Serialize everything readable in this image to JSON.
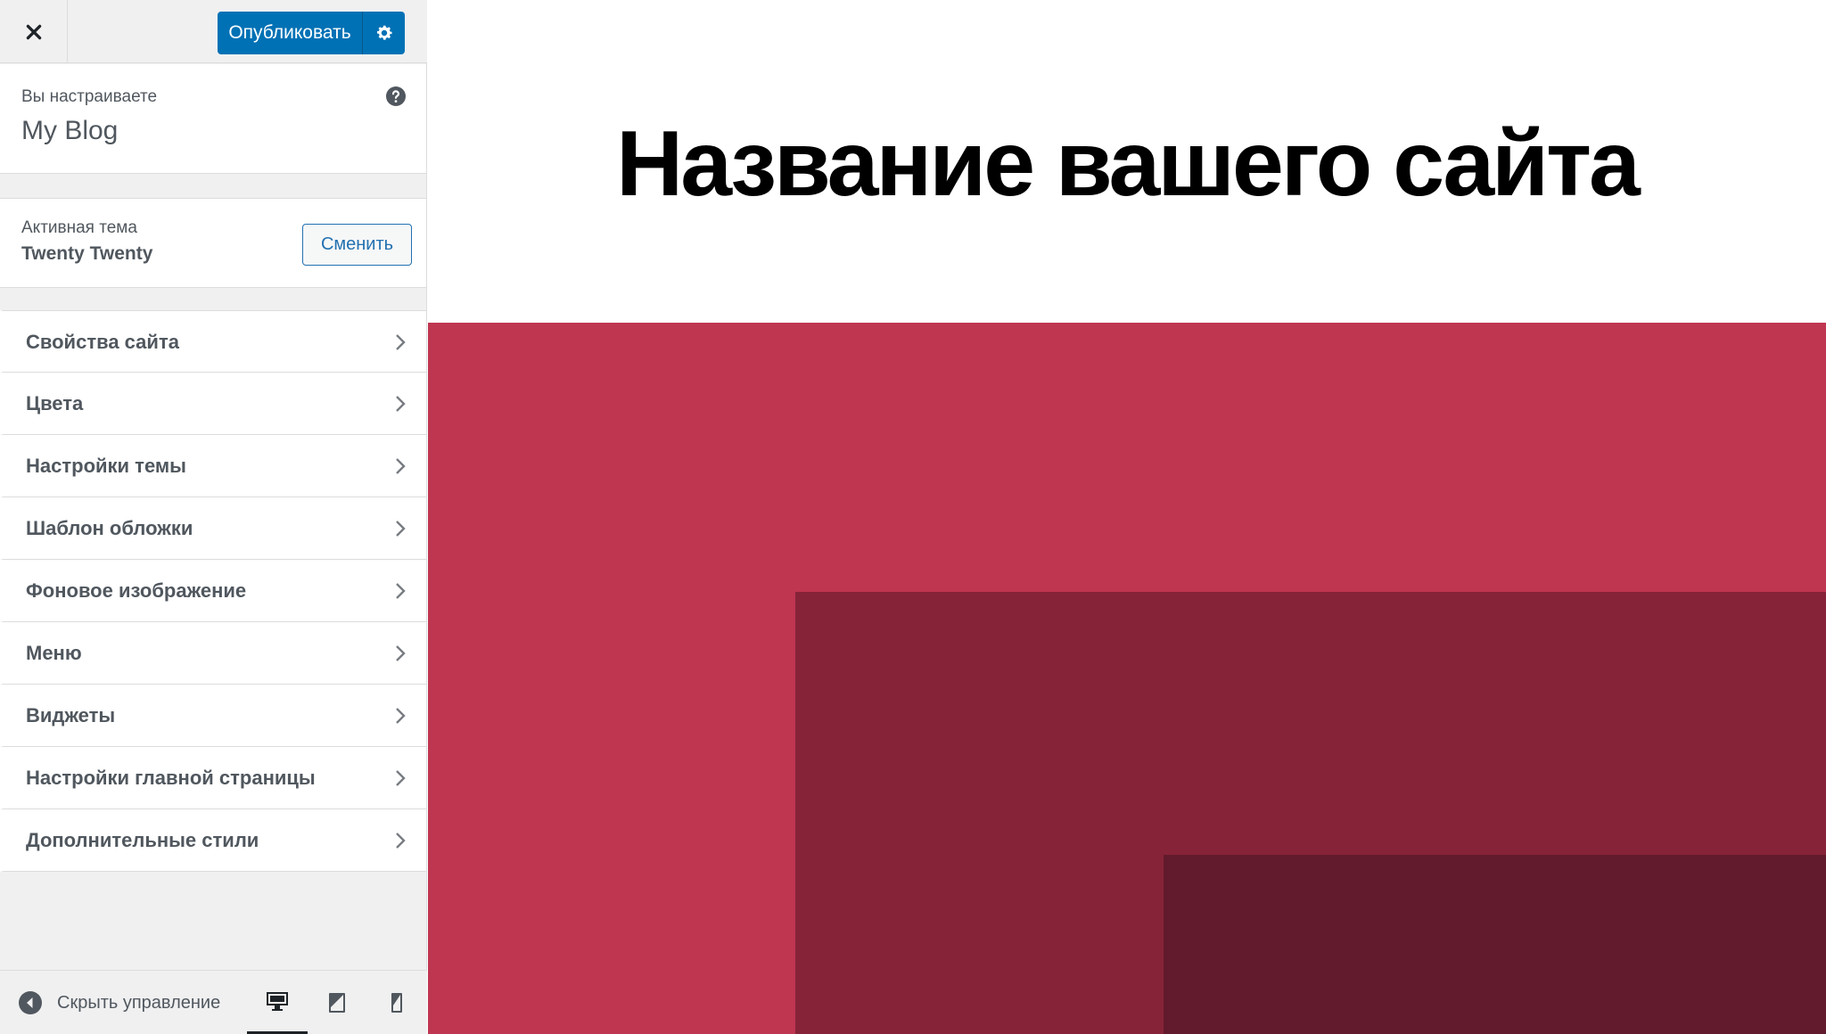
{
  "topbar": {
    "publish_label": "Опубликовать"
  },
  "info": {
    "caption": "Вы настраиваете",
    "site_name": "My Blog"
  },
  "theme": {
    "caption": "Активная тема",
    "name": "Twenty Twenty",
    "change_label": "Сменить"
  },
  "menu": {
    "items": [
      {
        "label": "Свойства сайта"
      },
      {
        "label": "Цвета"
      },
      {
        "label": "Настройки темы"
      },
      {
        "label": "Шаблон обложки"
      },
      {
        "label": "Фоновое изображение"
      },
      {
        "label": "Меню"
      },
      {
        "label": "Виджеты"
      },
      {
        "label": "Настройки главной страницы"
      },
      {
        "label": "Дополнительные стили"
      }
    ]
  },
  "footer": {
    "hide_label": "Скрыть управление",
    "devices": [
      "desktop-icon",
      "tablet-icon",
      "mobile-icon"
    ],
    "active_device": "desktop"
  },
  "preview": {
    "site_title": "Название вашего сайта"
  },
  "colors": {
    "accent": "#0071b5",
    "cover_primary": "#bf3651",
    "cover_mid": "#862338",
    "cover_dark": "#621b2c"
  },
  "icons": {
    "close": "close-icon",
    "publish_settings": "gear-icon",
    "help": "help-icon",
    "chevron": "chevron-right-icon",
    "hide_controls": "collapse-arrow-icon"
  }
}
